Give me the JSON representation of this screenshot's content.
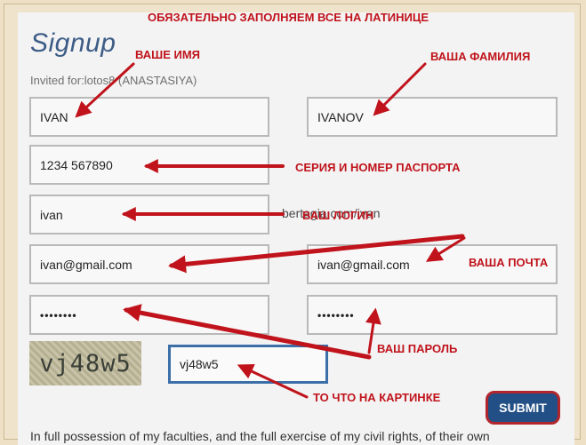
{
  "form": {
    "title": "Signup",
    "invited": "Invited for:lotos8 (ANASTASIYA)",
    "first_name": "IVAN",
    "last_name": "IVANOV",
    "passport": "1234 567890",
    "login": "ivan",
    "url_suffix": "bertagia.com/ivan",
    "email": "ivan@gmail.com",
    "email_confirm": "ivan@gmail.com",
    "password": "••••••••",
    "password_confirm": "••••••••",
    "captcha_image_text": "vj48w5",
    "captcha_input": "vj48w5",
    "submit": "SUBMIT",
    "legal_text": "In full possession of my faculties, and the full exercise of my civil rights, of their own"
  },
  "annotations": {
    "header": "ОБЯЗАТЕЛЬНО ЗАПОЛНЯЕМ ВСЕ НА ЛАТИНИЦЕ",
    "first_name": "ВАШЕ ИМЯ",
    "last_name": "ВАША ФАМИЛИЯ",
    "passport": "СЕРИЯ И НОМЕР ПАСПОРТА",
    "login": "ВАШ ЛОГИН",
    "email": "ВАША ПОЧТА",
    "password": "ВАШ ПАРОЛЬ",
    "captcha": "ТО ЧТО НА КАРТИНКЕ"
  },
  "colors": {
    "annotation": "#c0131b",
    "title": "#3d5c86",
    "submit_bg": "#224f85",
    "submit_border": "#b1252c"
  }
}
